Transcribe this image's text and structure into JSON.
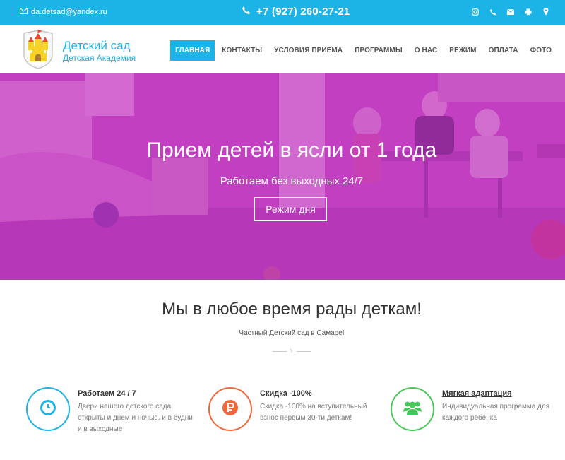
{
  "topbar": {
    "email": "da.detsad@yandex.ru",
    "phone": "+7 (927) 260-27-21",
    "social_icons": [
      "instagram-icon",
      "phone-icon",
      "mail-icon",
      "print-icon",
      "location-icon"
    ]
  },
  "header": {
    "brand_title": "Детский сад",
    "brand_subtitle": "Детская Академия",
    "nav": [
      {
        "label": "ГЛАВНАЯ",
        "active": true
      },
      {
        "label": "КОНТАКТЫ"
      },
      {
        "label": "УСЛОВИЯ ПРИЕМА"
      },
      {
        "label": "ПРОГРАММЫ"
      },
      {
        "label": "О НАС"
      },
      {
        "label": "РЕЖИМ"
      },
      {
        "label": "ОПЛАТА"
      },
      {
        "label": "ФОТО"
      }
    ]
  },
  "hero": {
    "title": "Прием детей в ясли от 1 года",
    "subtitle": "Работаем без выходных 24/7",
    "button": "Режим дня",
    "overlay_color": "#be28be"
  },
  "section": {
    "title": "Мы в любое время рады деткам!",
    "subtitle": "Частный Детский сад в Самаре!"
  },
  "features": [
    {
      "icon": "clock-icon",
      "color": "#1cb3e6",
      "title": "Работаем 24 / 7",
      "text": "Двери нашего детского сада открыты и днем и ночью, и в будни и в выходные"
    },
    {
      "icon": "ruble-icon",
      "color": "#f2673a",
      "title": "Скидка -100%",
      "text": "Скидка -100% на вступительный взнос первым 30-ти деткам!"
    },
    {
      "icon": "group-icon",
      "color": "#49c85a",
      "title": "Мягкая адаптация",
      "text": "Индивидуальная программа для каждого ребенка"
    }
  ],
  "colors": {
    "accent": "#1cb3e6",
    "orange": "#f2673a",
    "green": "#49c85a"
  }
}
